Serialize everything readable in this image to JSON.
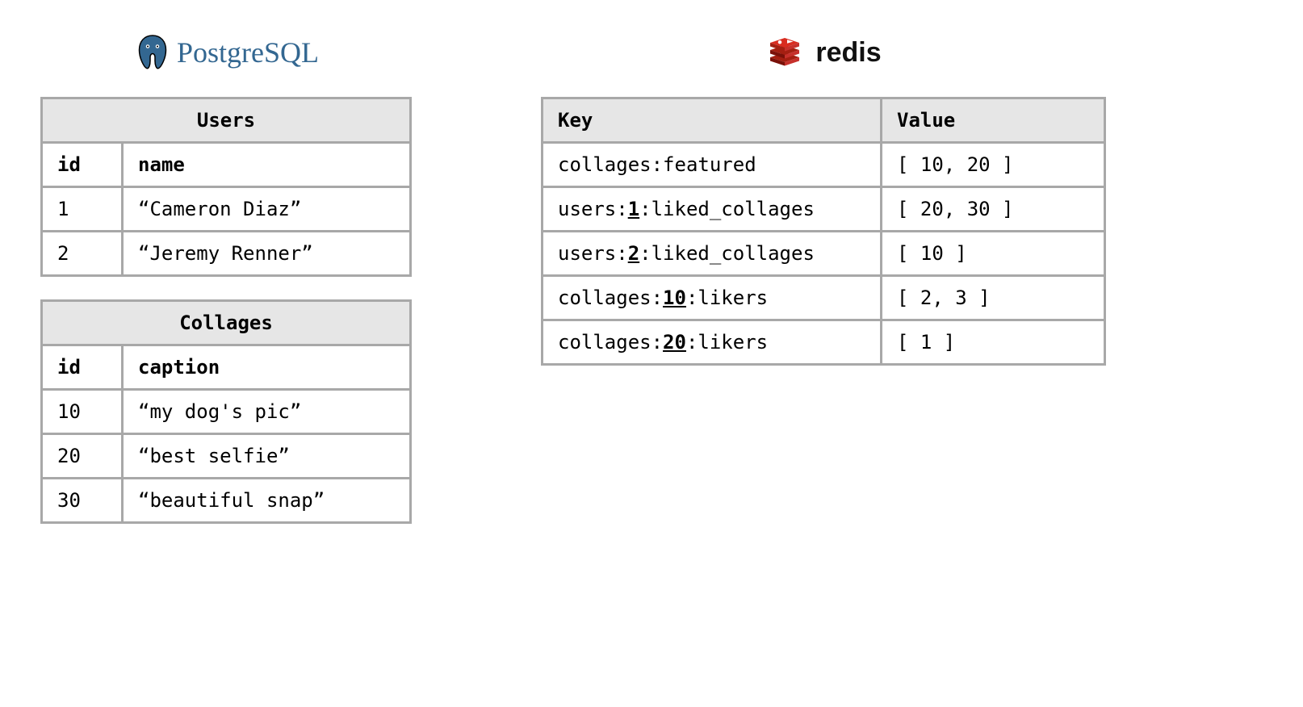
{
  "postgres": {
    "logo_text": "PostgreSQL",
    "users_table": {
      "title": "Users",
      "columns": [
        "id",
        "name"
      ],
      "rows": [
        {
          "id": "1",
          "name": "“Cameron Diaz”"
        },
        {
          "id": "2",
          "name": "“Jeremy Renner”"
        }
      ]
    },
    "collages_table": {
      "title": "Collages",
      "columns": [
        "id",
        "caption"
      ],
      "rows": [
        {
          "id": "10",
          "caption": "“my dog's pic”"
        },
        {
          "id": "20",
          "caption": "“best selfie”"
        },
        {
          "id": "30",
          "caption": "“beautiful snap”"
        }
      ]
    }
  },
  "redis": {
    "logo_text": "redis",
    "columns": [
      "Key",
      "Value"
    ],
    "rows": [
      {
        "key_parts": [
          "collages:featured"
        ],
        "underline_index": null,
        "value": "[ 10, 20 ]"
      },
      {
        "key_parts": [
          "users:",
          "1",
          ":liked_collages"
        ],
        "underline_index": 1,
        "value": "[ 20, 30 ]"
      },
      {
        "key_parts": [
          "users:",
          "2",
          ":liked_collages"
        ],
        "underline_index": 1,
        "value": "[ 10 ]"
      },
      {
        "key_parts": [
          "collages:",
          "10",
          ":likers"
        ],
        "underline_index": 1,
        "value": "[ 2, 3 ]"
      },
      {
        "key_parts": [
          "collages:",
          "20",
          ":likers"
        ],
        "underline_index": 1,
        "value": "[ 1 ]"
      }
    ]
  }
}
